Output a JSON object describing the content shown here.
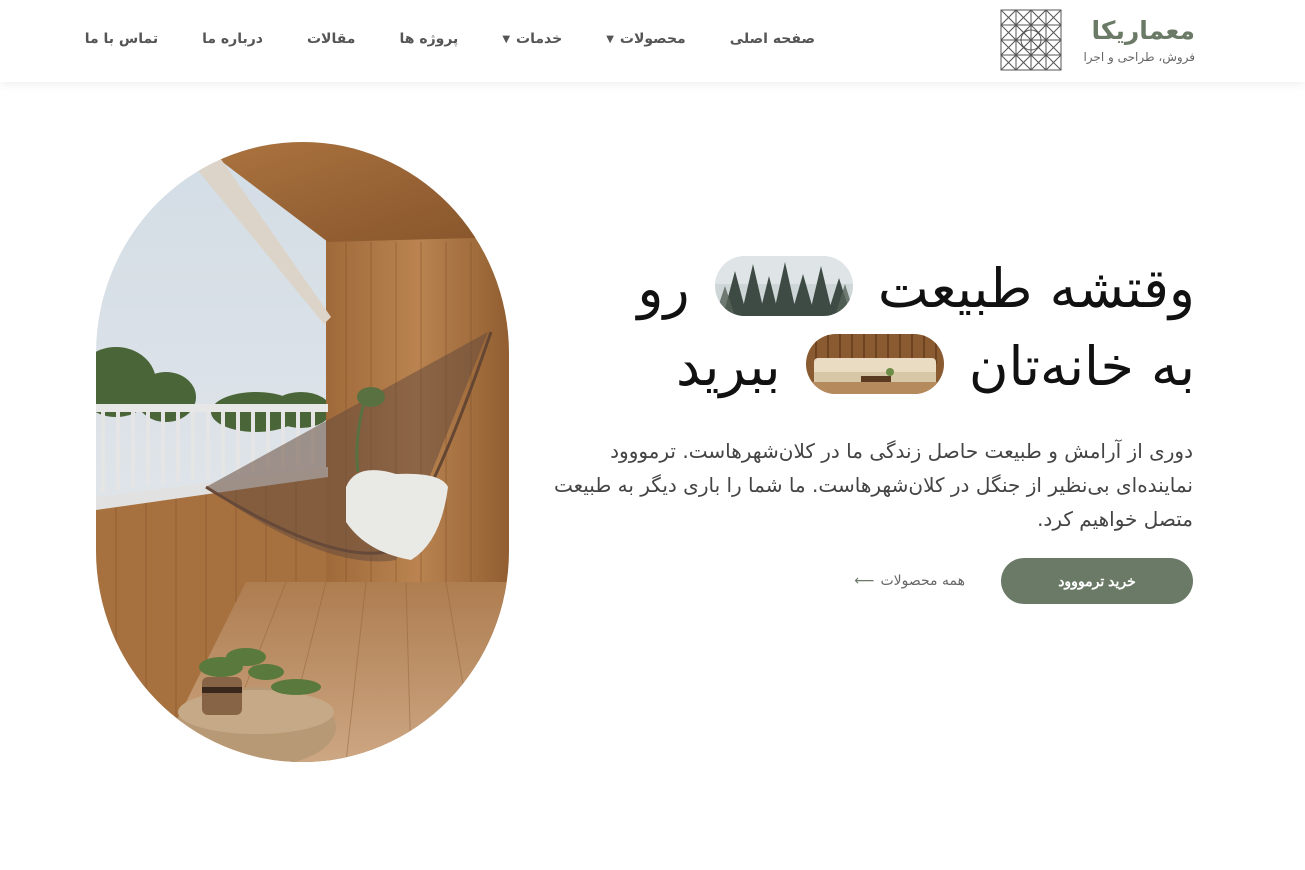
{
  "brand": {
    "name": "معماریکا",
    "tagline": "فروش، طراحی و اجرا",
    "color": "#6b7a66"
  },
  "nav": {
    "items": [
      {
        "label": "صفحه اصلی",
        "dropdown": false
      },
      {
        "label": "محصولات",
        "dropdown": true
      },
      {
        "label": "خدمات",
        "dropdown": true
      },
      {
        "label": "پروژه ها",
        "dropdown": false
      },
      {
        "label": "مقالات",
        "dropdown": false
      },
      {
        "label": "درباره ما",
        "dropdown": false
      },
      {
        "label": "تماس با ما",
        "dropdown": false
      }
    ],
    "caret_icon": "chevron-down-icon"
  },
  "hero": {
    "headline_part1": "وقتشه طبیعت",
    "headline_part2": "رو",
    "headline_part3": "به خانه‌تان",
    "headline_part4": "ببرید",
    "description": "دوری از آرامش و طبیعت حاصل زندگی ما در کلان‌شهرهاست. ترمووود نماینده‌ای بی‌نظیر از جنگل در کلان‌شهرهاست. ما شما را باری دیگر به طبیعت متصل خواهیم کرد.",
    "cta_primary": "خرید ترمووود",
    "cta_secondary": "همه محصولات",
    "arrow_icon": "arrow-left-icon"
  }
}
